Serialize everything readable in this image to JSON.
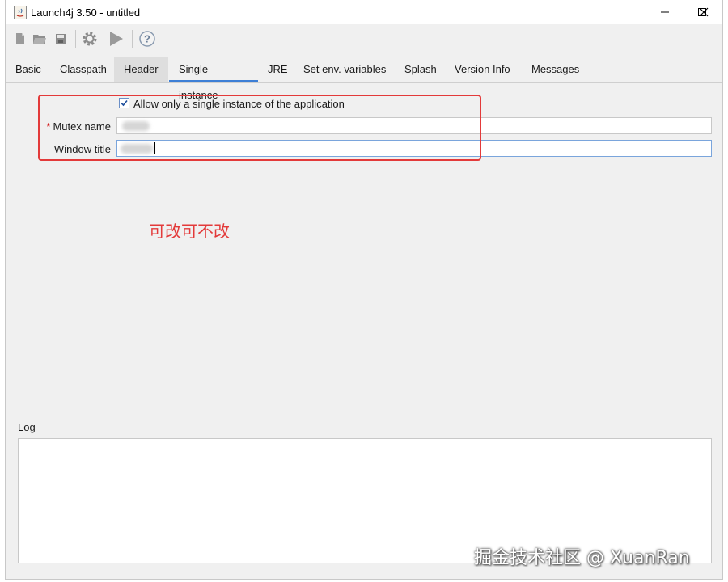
{
  "window": {
    "title": "Launch4j 3.50 - untitled"
  },
  "tabs": [
    {
      "label": "Basic"
    },
    {
      "label": "Classpath"
    },
    {
      "label": "Header"
    },
    {
      "label": "Single instance"
    },
    {
      "label": "JRE"
    },
    {
      "label": "Set env. variables"
    },
    {
      "label": "Splash"
    },
    {
      "label": "Version Info"
    },
    {
      "label": "Messages"
    }
  ],
  "single_instance": {
    "checkbox_label": "Allow only a single instance of the application",
    "checkbox_checked": true,
    "mutex_label": "Mutex name",
    "mutex_required_mark": "*",
    "window_title_label": "Window title"
  },
  "annotation_text": "可改可不改",
  "log": {
    "label": "Log"
  },
  "watermark": "掘金技术社区 @ XuanRan",
  "colors": {
    "accent": "#3d7fd6",
    "annotation": "#e33a3a"
  }
}
